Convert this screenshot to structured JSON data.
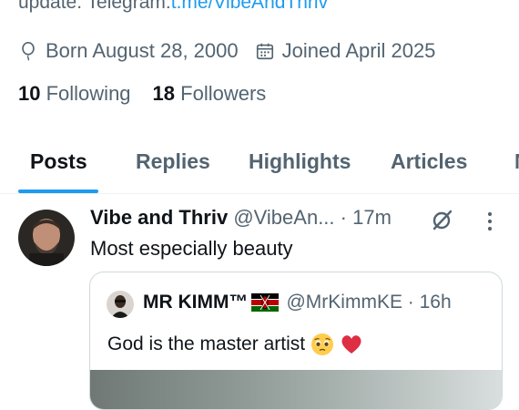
{
  "bio": {
    "text_prefix": "update. Telegram:",
    "link": "t.me/VibeAndThriv"
  },
  "meta": {
    "birth": "Born August 28, 2000",
    "joined": "Joined April 2025",
    "birth_icon": "balloon-icon",
    "joined_icon": "calendar-icon"
  },
  "stats": {
    "following_count": "10",
    "following_label": "Following",
    "followers_count": "18",
    "followers_label": "Followers"
  },
  "tabs": [
    {
      "label": "Posts",
      "active": true
    },
    {
      "label": "Replies"
    },
    {
      "label": "Highlights"
    },
    {
      "label": "Articles"
    },
    {
      "label": "M"
    }
  ],
  "post": {
    "name": "Vibe and Thriv",
    "handle": "@VibeAn...",
    "time": "· 17m",
    "text": "Most especially beauty",
    "quote": {
      "name": "MR KIMM™",
      "handle": "@MrKimmKE · 16h",
      "text": "God is the master artist"
    }
  },
  "colors": {
    "accent": "#1d9bf0",
    "secondary_text": "#536471",
    "primary_text": "#0f1419"
  }
}
